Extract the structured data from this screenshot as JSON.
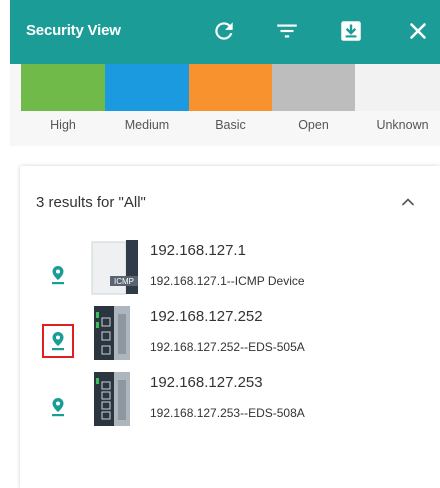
{
  "header": {
    "title": "Security View",
    "background": "#1b9c96",
    "buttons": {
      "refresh": "refresh-icon",
      "filter": "filter-icon",
      "export": "download-icon",
      "close": "close-icon"
    }
  },
  "legend": {
    "items": [
      {
        "label": "High",
        "color": "#6fba48"
      },
      {
        "label": "Medium",
        "color": "#1b9ae0"
      },
      {
        "label": "Basic",
        "color": "#f7922e"
      },
      {
        "label": "Open",
        "color": "#bdbdbd"
      },
      {
        "label": "Unknown",
        "color": "#f2f2f2"
      }
    ]
  },
  "results": {
    "summary": "3 results for \"All\"",
    "items": [
      {
        "ip": "192.168.127.1",
        "description": "192.168.127.1--ICMP Device",
        "device_icon": "icmp-device-icon",
        "device_badge": "ICMP"
      },
      {
        "ip": "192.168.127.252",
        "description": "192.168.127.252--EDS-505A",
        "device_icon": "eds-switch-icon"
      },
      {
        "ip": "192.168.127.253",
        "description": "192.168.127.253--EDS-508A",
        "device_icon": "eds-switch-icon"
      }
    ],
    "pin_color": "#1b9c96",
    "selected_highlight": "#e02020"
  }
}
